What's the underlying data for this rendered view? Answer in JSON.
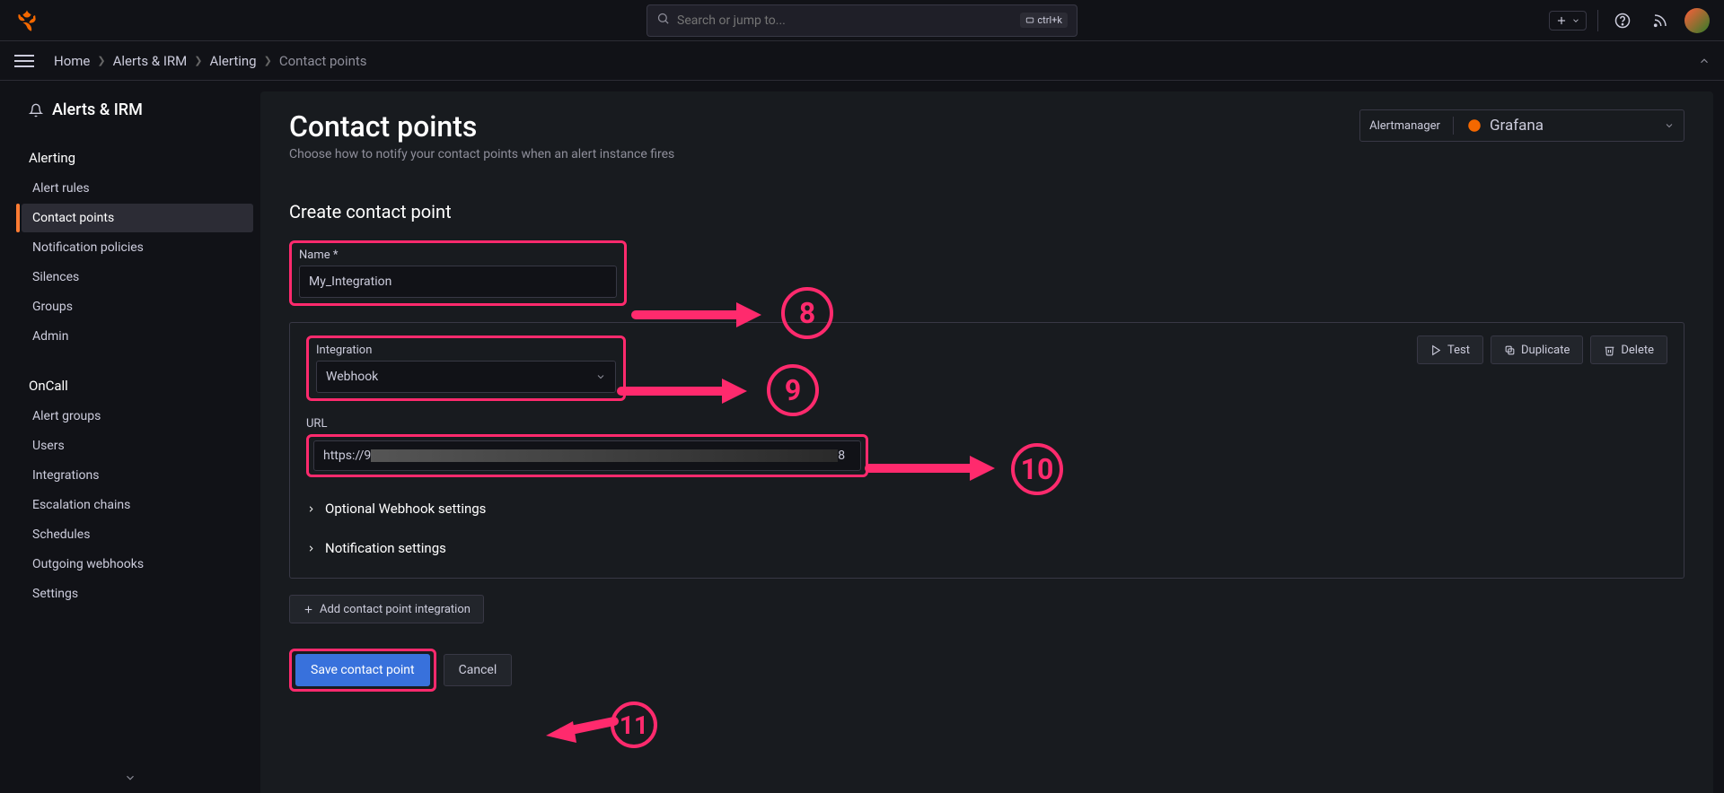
{
  "topbar": {
    "search_placeholder": "Search or jump to...",
    "shortcut": "ctrl+k"
  },
  "breadcrumbs": {
    "home": "Home",
    "alerts_irm": "Alerts & IRM",
    "alerting": "Alerting",
    "current": "Contact points"
  },
  "sidebar": {
    "section_title": "Alerts & IRM",
    "alerting": {
      "header": "Alerting",
      "items": [
        "Alert rules",
        "Contact points",
        "Notification policies",
        "Silences",
        "Groups",
        "Admin"
      ]
    },
    "oncall": {
      "header": "OnCall",
      "items": [
        "Alert groups",
        "Users",
        "Integrations",
        "Escalation chains",
        "Schedules",
        "Outgoing webhooks",
        "Settings"
      ]
    }
  },
  "page": {
    "title": "Contact points",
    "subtitle": "Choose how to notify your contact points when an alert instance fires",
    "alertmanager_label": "Alertmanager",
    "alertmanager_value": "Grafana"
  },
  "form": {
    "section_title": "Create contact point",
    "name_label": "Name *",
    "name_value": "My_Integration",
    "integration_label": "Integration",
    "integration_value": "Webhook",
    "url_label": "URL",
    "url_prefix": "https://9",
    "url_suffix": "8",
    "test_btn": "Test",
    "duplicate_btn": "Duplicate",
    "delete_btn": "Delete",
    "optional_settings": "Optional Webhook settings",
    "notification_settings": "Notification settings",
    "add_integration_btn": "Add contact point integration",
    "save_btn": "Save contact point",
    "cancel_btn": "Cancel"
  },
  "tutorial": {
    "step8": "8",
    "step9": "9",
    "step10": "10",
    "step11": "11"
  }
}
